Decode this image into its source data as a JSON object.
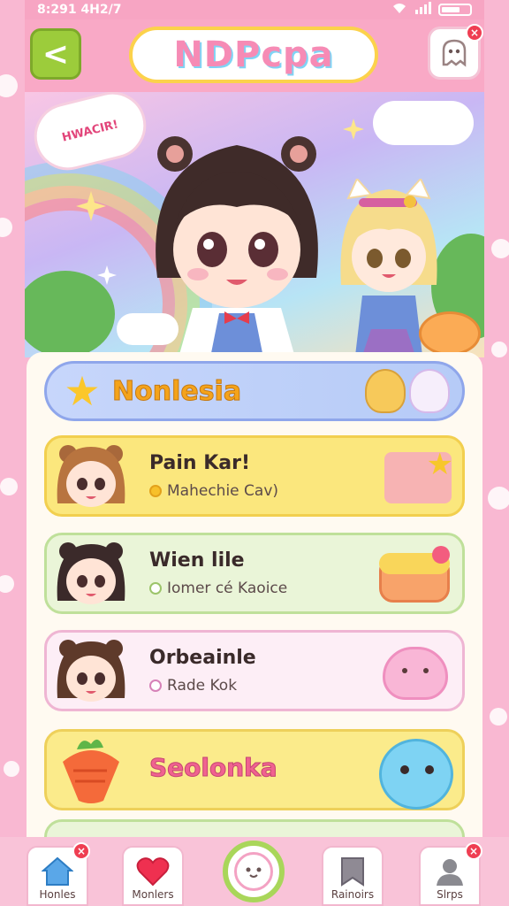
{
  "status_bar": {
    "time": "8:291 4H2/7"
  },
  "header": {
    "back_label": "<",
    "title": "NDPcpa",
    "notif_badge": "×",
    "notif_icon": "ghost-icon"
  },
  "hero": {
    "bubble_text": "HWACIR!"
  },
  "section": {
    "title": "Nonlesia",
    "icon": "star-icon"
  },
  "list": [
    {
      "name": "Pain Kar!",
      "sub": "Mahechie Cav)",
      "deco": "star-card-icon"
    },
    {
      "name": "Wien lile",
      "sub": "Iomer cé Kaoice",
      "deco": "cake-icon"
    },
    {
      "name": "Orbeainle",
      "sub": "Rade Kok",
      "deco": "slime-icon"
    },
    {
      "name": "Seolonka",
      "sub": "",
      "deco": "cat-blob-icon"
    }
  ],
  "nav": {
    "items": [
      {
        "label": "Honles",
        "icon": "home-icon",
        "badge": "×"
      },
      {
        "label": "Monlers",
        "icon": "heart-icon"
      },
      {
        "label": "",
        "icon": "face-icon"
      },
      {
        "label": "Rainoirs",
        "icon": "bookmark-icon"
      },
      {
        "label": "Slrps",
        "icon": "person-icon",
        "badge": "×"
      }
    ]
  },
  "colors": {
    "accent_pink": "#f9a9c6",
    "accent_green": "#9ccc3b",
    "row1": "#fbe77d",
    "row2": "#eaf5d8",
    "row3": "#fdeef6",
    "row4": "#fbeb8b"
  }
}
